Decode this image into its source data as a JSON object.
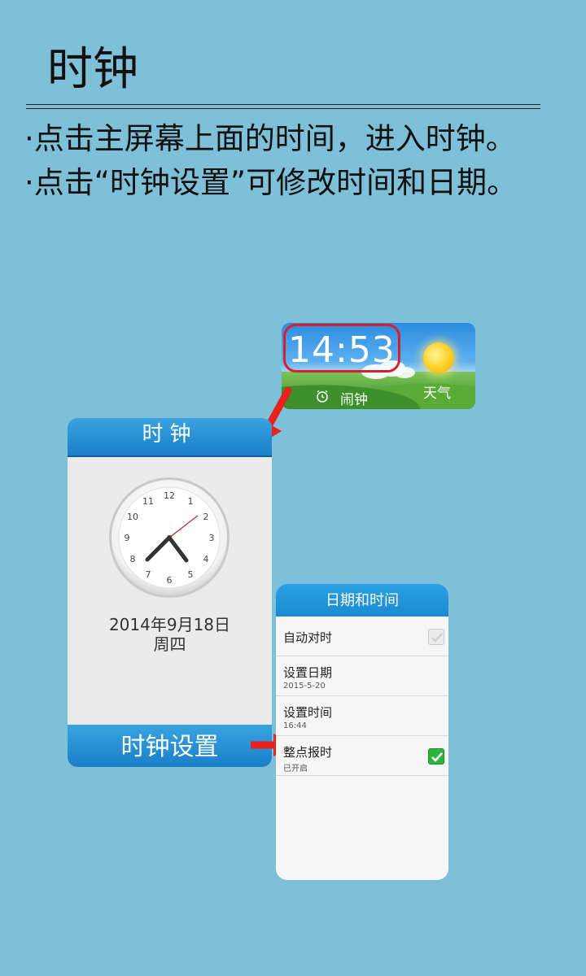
{
  "page": {
    "title": "时钟",
    "instructions": [
      "·点击主屏幕上面的时间，进入时钟。",
      "·点击“时钟设置”可修改时间和日期。"
    ]
  },
  "widget": {
    "time": "14:53",
    "alarm_label": "闹钟",
    "weather_label": "天气",
    "alarm_icon": "alarm-clock-icon",
    "weather_icon": "sun-icon"
  },
  "clock_panel": {
    "header": "时钟",
    "numerals": [
      "12",
      "1",
      "2",
      "3",
      "4",
      "5",
      "6",
      "7",
      "8",
      "9",
      "10",
      "11"
    ],
    "date": "2014年9月18日",
    "weekday": "周四",
    "footer_button": "时钟设置"
  },
  "settings_panel": {
    "header": "日期和时间",
    "rows": [
      {
        "label": "自动对时",
        "sub": "",
        "checkbox": "off"
      },
      {
        "label": "设置日期",
        "sub": "2015-5-20"
      },
      {
        "label": "设置时间",
        "sub": "16:44"
      },
      {
        "label": "整点报时",
        "sub": "已开启",
        "checkbox": "on"
      }
    ]
  },
  "colors": {
    "background": "#7ec0d8",
    "header_blue": "#1a7fc8",
    "highlight_red": "#d8202a",
    "arrow_red": "#e8231f",
    "check_green": "#2db33d"
  }
}
